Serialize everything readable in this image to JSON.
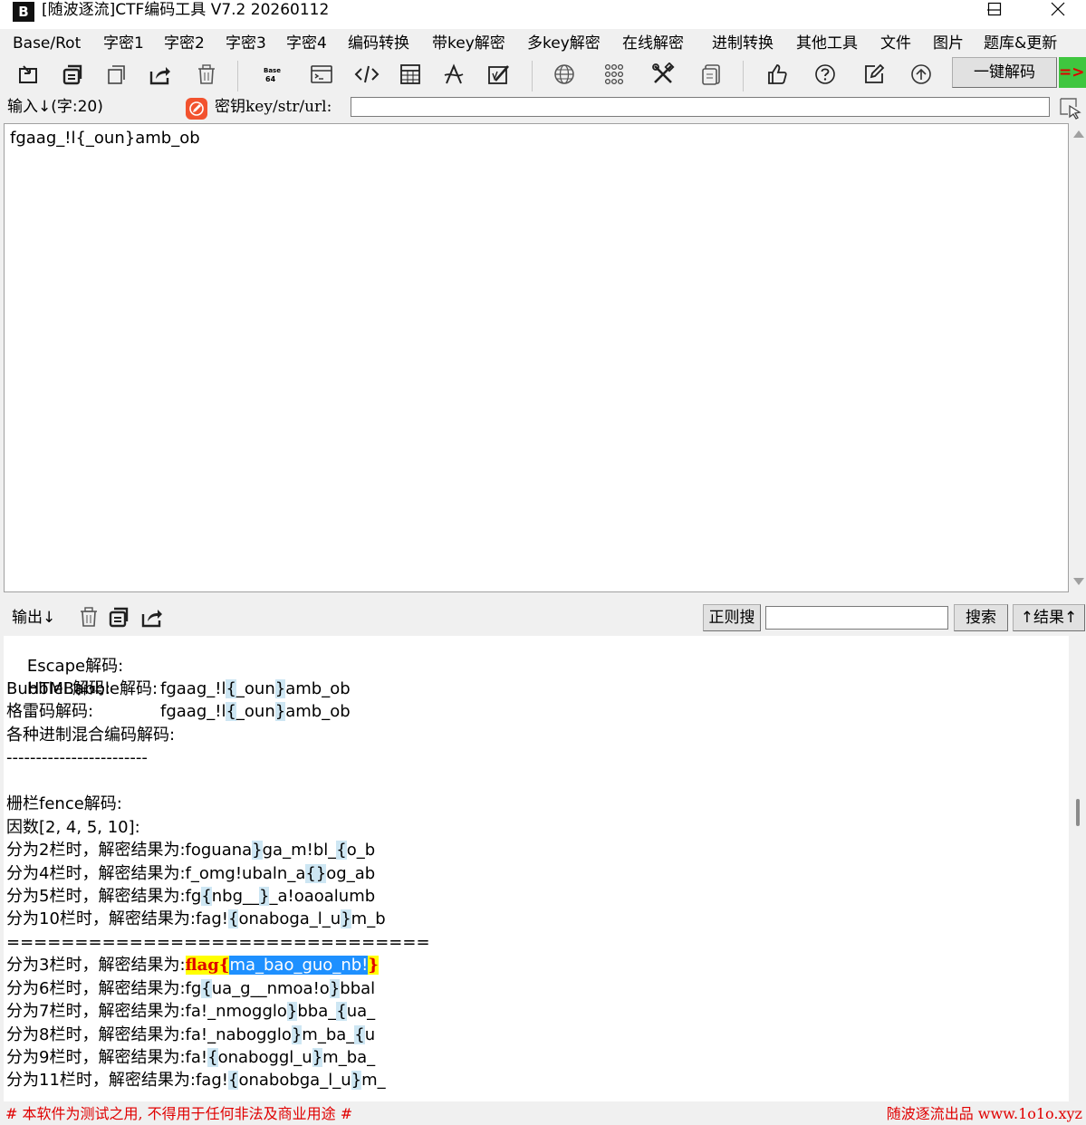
{
  "window": {
    "logo": "B",
    "title": "[随波逐流]CTF编码工具 V7.2  20260112",
    "buttons": [
      "minimize-icon",
      "maximize-icon",
      "close-icon"
    ]
  },
  "menu": [
    "Base/Rot",
    "字密1",
    "字密2",
    "字密3",
    "字密4",
    "编码转换",
    "带key解密",
    "多key解密",
    "在线解密",
    "进制转换",
    "其他工具",
    "文件",
    "图片",
    "题库&更新"
  ],
  "toolbar": {
    "icons": [
      "import-icon",
      "copy-icon",
      "paste-icon",
      "share-icon",
      "trash-icon",
      "base64-icon",
      "terminal-icon",
      "code-icon",
      "table-icon",
      "text-a-icon",
      "image-edit-icon",
      "globe-icon",
      "grid-icon",
      "tools-icon",
      "document-icon",
      "thumbs-up-icon",
      "help-icon",
      "edit-icon",
      "update-icon"
    ],
    "one_key_decode": "一键解码",
    "green_button": "=>"
  },
  "input": {
    "label": "输入↓(字:20)",
    "key_label": "密钥key/str/url:",
    "key_value": "",
    "text": "fgaag_!l{_oun}amb_ob"
  },
  "output": {
    "label": "输出↓",
    "regex_label": "正则搜",
    "regex_value": "",
    "search_label": "搜索",
    "results_label": "↑结果↑",
    "escape_label": "Escape解码:",
    "escape_value": [
      "fgaag_!l",
      "{",
      "_oun",
      "}",
      "amb_ob"
    ],
    "html_label": "HTML解码:",
    "html_value": [
      "fgaag_!l",
      "{",
      "_oun",
      "}",
      "amb_ob"
    ],
    "bubble_label": "BubbleBabble解码:",
    "gray_label": "格雷码解码:",
    "mixed_label": "各种进制混合编码解码:",
    "separator_dash": "------------------------",
    "fence_label": "栅栏fence解码:",
    "factors_label": "因数[2, 4, 5, 10]:",
    "rows_a": [
      {
        "prefix": "分为2栏时，解密结果为:",
        "parts": [
          "foguana",
          "}",
          "ga_m!bl_",
          "{",
          "o_b"
        ]
      },
      {
        "prefix": "分为4栏时，解密结果为:",
        "parts": [
          "f_omg!ubaln_a",
          "{}",
          "og_ab"
        ]
      },
      {
        "prefix": "分为5栏时，解密结果为:",
        "parts": [
          "fg",
          "{",
          "nbg__",
          "}",
          "_a!oaoalumb"
        ]
      },
      {
        "prefix": "分为10栏时，解密结果为:",
        "parts": [
          "fag!",
          "{",
          "onaboga_l_u",
          "}",
          "m_b"
        ]
      }
    ],
    "separator_eq": "===============================",
    "flag_row": {
      "prefix": "分为3栏时，解密结果为:",
      "flag": "flag",
      "brace_open": "{",
      "selected": "ma_bao_guo_nb!",
      "brace_close": "}"
    },
    "rows_b": [
      {
        "prefix": "分为6栏时，解密结果为:",
        "parts": [
          "fg",
          "{",
          "ua_g__nmoa!o",
          "}",
          "bbal"
        ]
      },
      {
        "prefix": "分为7栏时，解密结果为:",
        "parts": [
          "fa!_nmogglo",
          "}",
          "bba_",
          "{",
          "ua_"
        ]
      },
      {
        "prefix": "分为8栏时，解密结果为:",
        "parts": [
          "fa!_nabogglo",
          "}",
          "m_ba_",
          "{",
          "u"
        ]
      },
      {
        "prefix": "分为9栏时，解密结果为:",
        "parts": [
          "fa!",
          "{",
          "onaboggl_u",
          "}",
          "m_ba_"
        ]
      },
      {
        "prefix": "分为11栏时，解密结果为:",
        "parts": [
          "fag!",
          "{",
          "onabobga_l_u",
          "}",
          "m_"
        ]
      }
    ]
  },
  "status": {
    "left": "# 本软件为测试之用, 不得用于任何非法及商业用途 #",
    "right": "随波逐流出品 www.1o1o.xyz"
  }
}
